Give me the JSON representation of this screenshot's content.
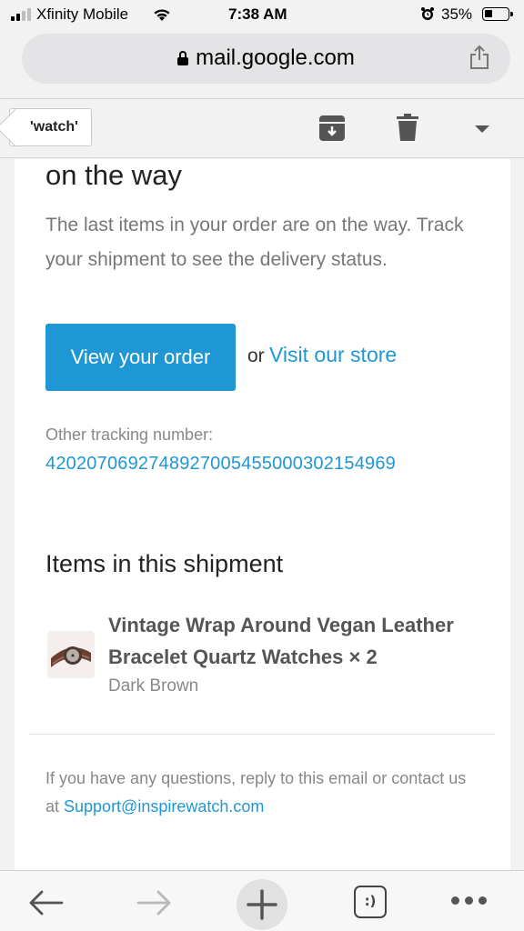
{
  "status_bar": {
    "carrier": "Xfinity Mobile",
    "time": "7:38 AM",
    "battery": "35%",
    "icons": [
      "signal-icon",
      "wifi-icon",
      "alarm-icon",
      "battery-icon"
    ]
  },
  "browser": {
    "url": "mail.google.com",
    "icons": [
      "lock-icon",
      "share-icon"
    ]
  },
  "gmail_toolbar": {
    "back_label": "'watch'",
    "icons": [
      "archive-icon",
      "trash-icon",
      "more-actions-caret-icon"
    ]
  },
  "email": {
    "heading": "on the way",
    "message": "The last items in your order are on the way. Track your shipment to see the delivery status.",
    "primary_button": "View your order",
    "or_text": "or",
    "store_link": "Visit our store",
    "tracking_label": "Other tracking number:",
    "tracking_number": "420207069274892700545500030215496​9",
    "section_title": "Items in this shipment",
    "item": {
      "title": "Vintage Wrap Around Vegan Leather Bracelet Quartz Watches × 2",
      "variant": "Dark Brown"
    },
    "footer_prefix": "If you have any questions, reply to this email or contact us at ",
    "support_email": "Support@inspirewatch.com"
  },
  "colors": {
    "accent": "#1f97d5",
    "muted_text": "#777777",
    "page_background": "#f2f2f2"
  },
  "bottom_bar": {
    "tabs_label": ":)",
    "icons": [
      "back-arrow-icon",
      "forward-arrow-icon",
      "plus-icon",
      "tabs-icon",
      "more-icon"
    ]
  }
}
